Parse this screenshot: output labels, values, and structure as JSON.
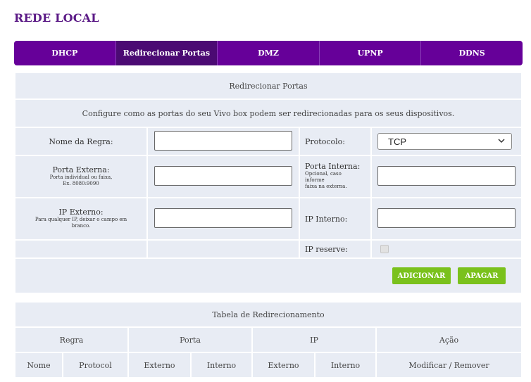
{
  "page": {
    "title": "REDE LOCAL"
  },
  "tabs": [
    {
      "label": "DHCP"
    },
    {
      "label": "Redirecionar Portas"
    },
    {
      "label": "DMZ"
    },
    {
      "label": "UPNP"
    },
    {
      "label": "DDNS"
    }
  ],
  "form": {
    "header": "Redirecionar Portas",
    "description": "Configure como as portas do seu Vivo box podem ser redirecionadas para os seus dispositivos.",
    "rule_name_label": "Nome da Regra:",
    "protocol_label": "Protocolo:",
    "protocol_value": "TCP",
    "external_port_label": "Porta Externa:",
    "external_port_hint_1": "Porta individual ou faixa,",
    "external_port_hint_2": "Ex. 8080:9090",
    "internal_port_label": "Porta Interna:",
    "internal_port_hint_1": "Opcional, caso",
    "internal_port_hint_2": "informe",
    "internal_port_hint_3": "faixa na externa.",
    "external_ip_label": "IP Externo:",
    "external_ip_hint_1": "Para qualquer IP, deixar o campo em",
    "external_ip_hint_2": "branco.",
    "internal_ip_label": "IP Interno:",
    "ip_reserve_label": "IP reserve:",
    "add_button": "ADICIONAR",
    "clear_button": "APAGAR"
  },
  "table": {
    "title": "Tabela de Redirecionamento",
    "groups": {
      "rule": "Regra",
      "port": "Porta",
      "ip": "IP",
      "action": "Ação"
    },
    "columns": {
      "name": "Nome",
      "protocol": "Protocol",
      "port_external": "Externo",
      "port_internal": "Interno",
      "ip_external": "Externo",
      "ip_internal": "Interno",
      "action": "Modificar / Remover"
    }
  }
}
